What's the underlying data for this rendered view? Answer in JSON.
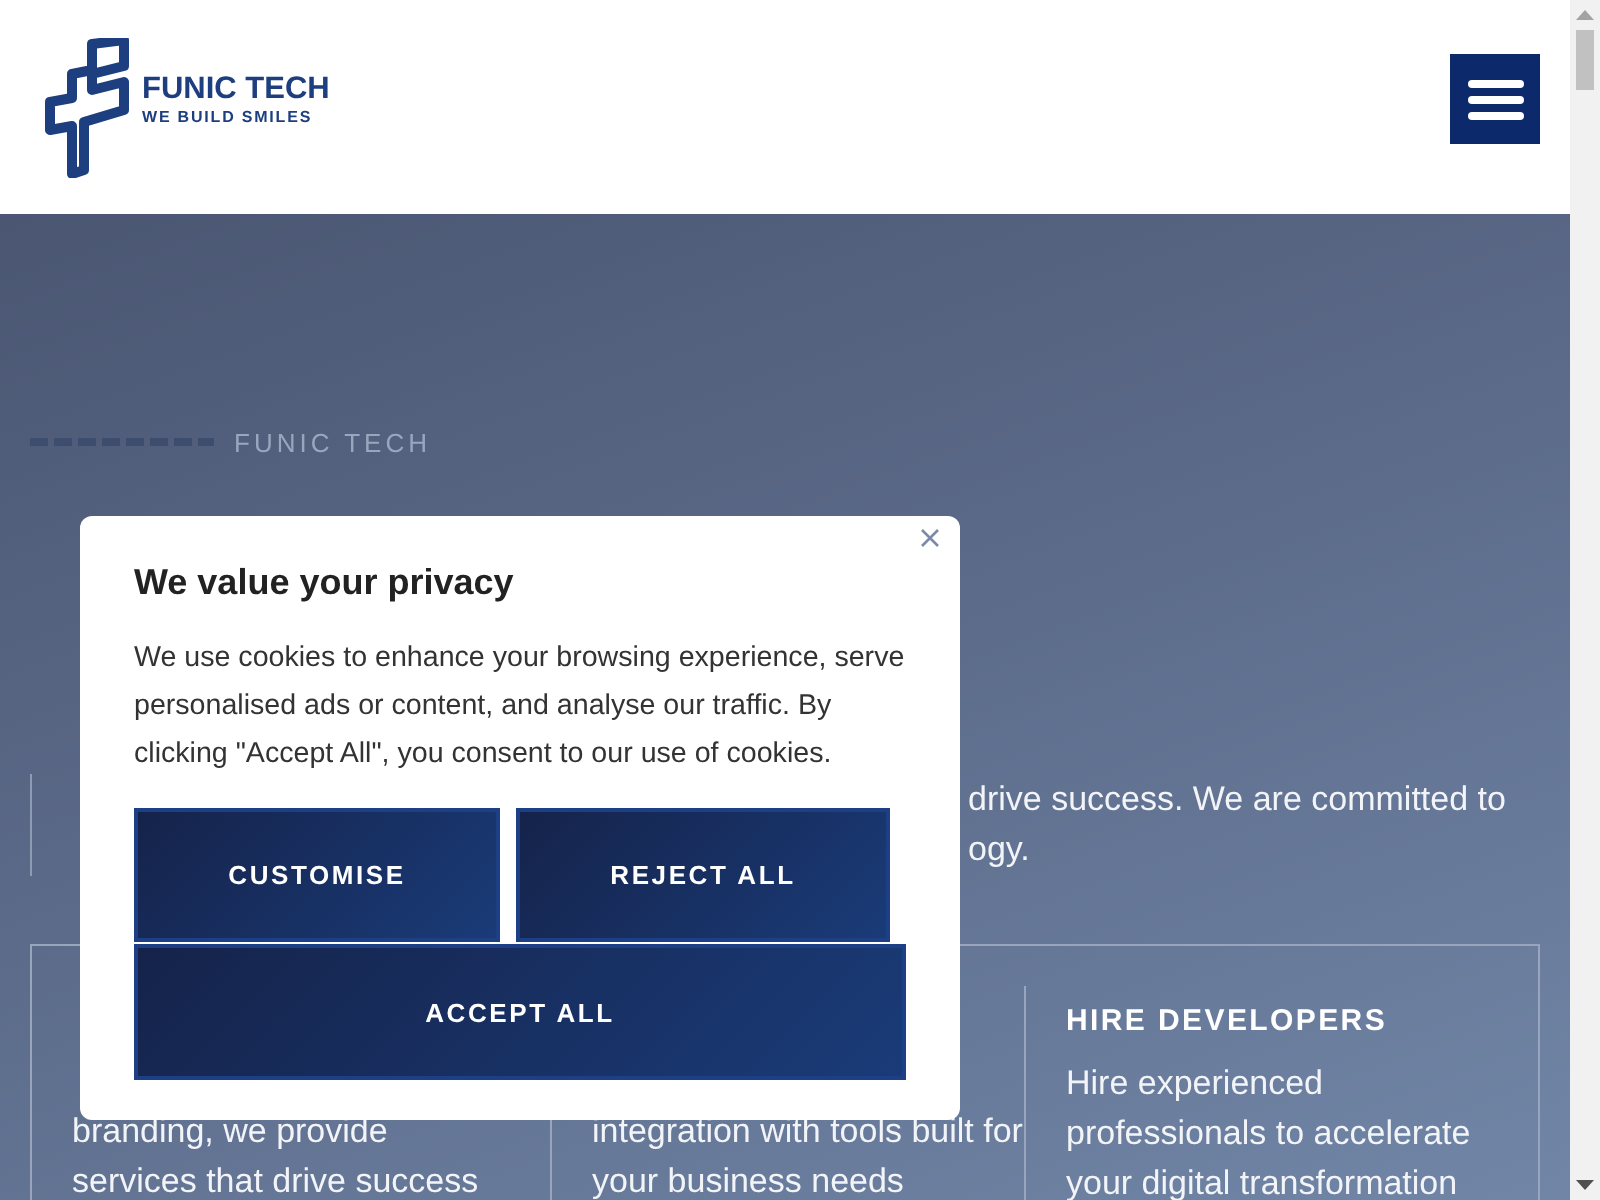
{
  "header": {
    "logo": {
      "name": "FUNIC TECH",
      "tagline": "WE BUILD SMILES"
    }
  },
  "hero": {
    "eyebrow": "FUNIC TECH",
    "paragraph_lines": [
      "drive success. We are committed to",
      "ogy."
    ]
  },
  "services": [
    {
      "lines": [
        "branding, we provide",
        "services that drive success"
      ]
    },
    {
      "lines": [
        "integration with tools built for",
        "your business needs"
      ]
    },
    {
      "title": "HIRE DEVELOPERS",
      "lines": [
        "Hire experienced",
        "professionals to accelerate",
        "your digital transformation"
      ]
    }
  ],
  "cookie_dialog": {
    "title": "We value your privacy",
    "text": "We use cookies to enhance your browsing experience, serve personalised ads or content, and analyse our traffic. By clicking \"Accept All\", you consent to our use of cookies.",
    "buttons": [
      "CUSTOMISE",
      "REJECT ALL"
    ],
    "accept_button": "ACCEPT ALL"
  }
}
